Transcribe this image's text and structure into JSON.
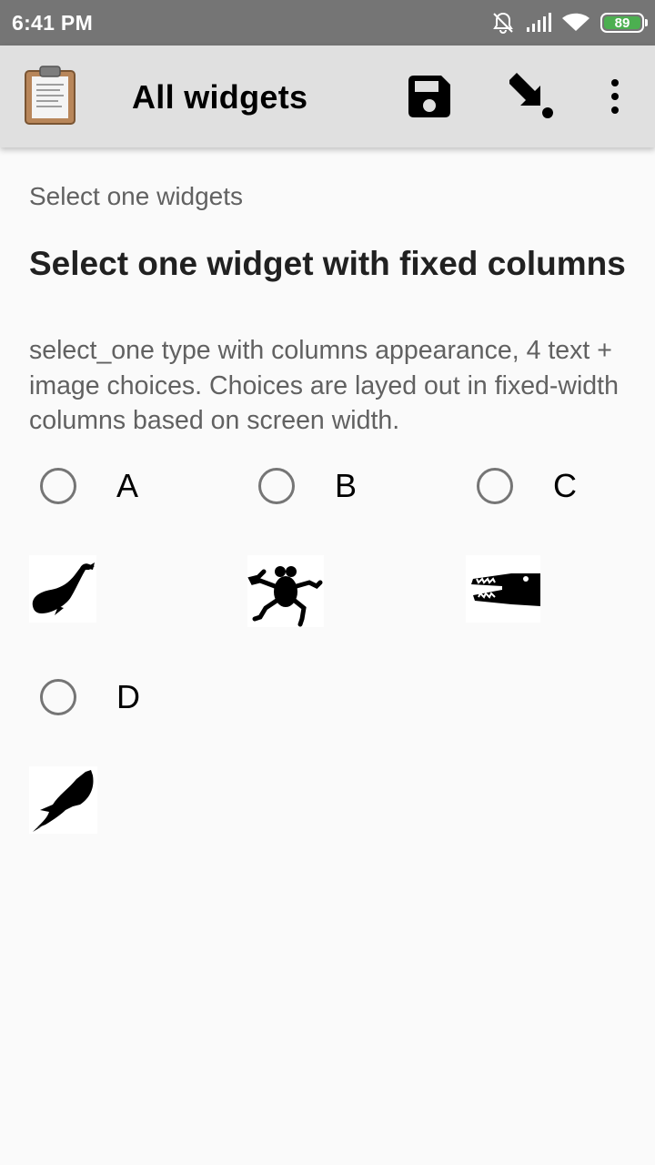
{
  "status_bar": {
    "time": "6:41 PM",
    "battery_level": "89",
    "battery_color": "#4caf50",
    "icons": [
      "mute-bell-icon",
      "signal-icon",
      "wifi-icon",
      "battery-icon"
    ]
  },
  "toolbar": {
    "title": "All widgets",
    "icons": [
      "clipboard-app-icon",
      "save-icon",
      "jump-arrow-icon",
      "more-vert-icon"
    ]
  },
  "form": {
    "group_label": "Select one widgets",
    "question_title": "Select one widget with fixed columns",
    "question_hint": "select_one type with columns appearance, 4 text + image choices. Choices are layed out in fixed-width columns based on screen width.",
    "choices": [
      {
        "label": "A",
        "image": "whale-icon",
        "selected": false
      },
      {
        "label": "B",
        "image": "frog-icon",
        "selected": false
      },
      {
        "label": "C",
        "image": "crocodile-icon",
        "selected": false
      },
      {
        "label": "D",
        "image": "eagle-icon",
        "selected": false
      }
    ]
  },
  "colors": {
    "status_bar_bg": "#757575",
    "toolbar_bg": "#e0e0e0",
    "page_bg": "#fafafa",
    "radio_border": "#757575"
  }
}
